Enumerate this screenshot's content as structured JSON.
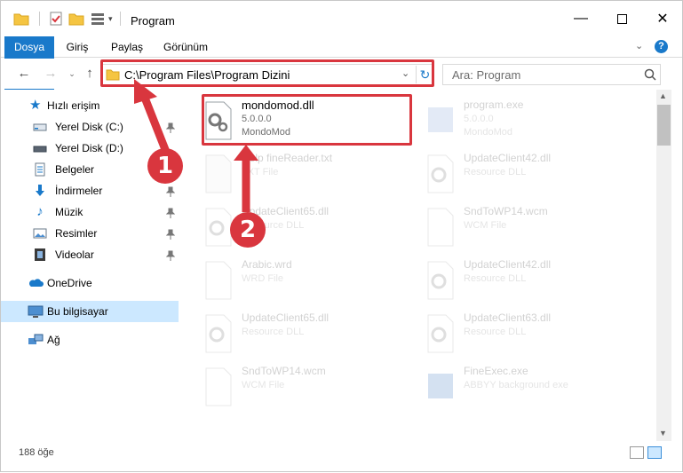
{
  "window": {
    "title": "Program"
  },
  "ribbon": {
    "tabs": [
      "Dosya",
      "Giriş",
      "Paylaş",
      "Görünüm"
    ]
  },
  "address": {
    "path": "C:\\Program Files\\Program Dizini",
    "search_placeholder": "Ara: Program"
  },
  "nav": {
    "quick_access": "Hızlı erişim",
    "items": [
      "Yerel Disk (C:)",
      "Yerel Disk (D:)",
      "Belgeler",
      "İndirmeler",
      "Müzik",
      "Resimler",
      "Videolar"
    ],
    "onedrive": "OneDrive",
    "thispc": "Bu bilgisayar",
    "network": "Ağ"
  },
  "files": {
    "highlight": {
      "name": "mondomod.dll",
      "version": "5.0.0.0",
      "company": "MondoMod"
    },
    "others": [
      {
        "name": "program.exe",
        "l2": "5.0.0.0",
        "l3": "MondoMod"
      },
      {
        "name": "Help fineReader.txt",
        "l2": "TXT File",
        "l3": ""
      },
      {
        "name": "UpdateClient42.dll",
        "l2": "Resource DLL",
        "l3": ""
      },
      {
        "name": "UpdateClient65.dll",
        "l2": "Resource DLL",
        "l3": ""
      },
      {
        "name": "SndToWP14.wcm",
        "l2": "WCM File",
        "l3": ""
      },
      {
        "name": "Arabic.wrd",
        "l2": "WRD File",
        "l3": ""
      },
      {
        "name": "UpdateClient42.dll",
        "l2": "Resource DLL",
        "l3": ""
      },
      {
        "name": "UpdateClient65.dll",
        "l2": "Resource DLL",
        "l3": ""
      },
      {
        "name": "UpdateClient63.dll",
        "l2": "Resource DLL",
        "l3": ""
      },
      {
        "name": "SndToWP14.wcm",
        "l2": "WCM File",
        "l3": ""
      },
      {
        "name": "FineExec.exe",
        "l2": "ABBYY background exe",
        "l3": ""
      }
    ]
  },
  "status": {
    "count": "188 öğe"
  },
  "callouts": [
    "1",
    "2"
  ],
  "colors": {
    "accent": "#1979ca",
    "highlight_red": "#d9363e",
    "selection": "#cce8ff"
  }
}
